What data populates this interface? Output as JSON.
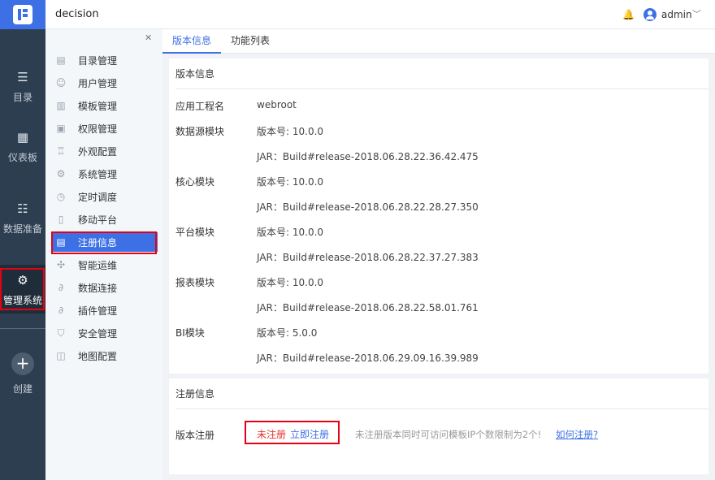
{
  "rail": {
    "items": [
      {
        "label": "目录",
        "icon": "list-icon"
      },
      {
        "label": "仪表板",
        "icon": "dashboard-icon"
      },
      {
        "label": "数据准备",
        "icon": "database-icon"
      },
      {
        "label": "管理系统",
        "icon": "gear-icon"
      }
    ],
    "create_label": "创建"
  },
  "header": {
    "title": "decision",
    "user": "admin"
  },
  "subnav": {
    "items": [
      {
        "label": "目录管理"
      },
      {
        "label": "用户管理"
      },
      {
        "label": "模板管理"
      },
      {
        "label": "权限管理"
      },
      {
        "label": "外观配置"
      },
      {
        "label": "系统管理"
      },
      {
        "label": "定时调度"
      },
      {
        "label": "移动平台"
      },
      {
        "label": "注册信息"
      },
      {
        "label": "智能运维"
      },
      {
        "label": "数据连接"
      },
      {
        "label": "插件管理"
      },
      {
        "label": "安全管理"
      },
      {
        "label": "地图配置"
      }
    ]
  },
  "tabs": [
    {
      "label": "版本信息"
    },
    {
      "label": "功能列表"
    }
  ],
  "version_panel": {
    "title": "版本信息",
    "app_label": "应用工程名",
    "app_value": "webroot",
    "modules": [
      {
        "name": "数据源模块",
        "version": "版本号: 10.0.0",
        "jar": "JAR：Build#release-2018.06.28.22.36.42.475"
      },
      {
        "name": "核心模块",
        "version": "版本号: 10.0.0",
        "jar": "JAR：Build#release-2018.06.28.22.28.27.350"
      },
      {
        "name": "平台模块",
        "version": "版本号: 10.0.0",
        "jar": "JAR：Build#release-2018.06.28.22.37.27.383"
      },
      {
        "name": "报表模块",
        "version": "版本号: 10.0.0",
        "jar": "JAR：Build#release-2018.06.28.22.58.01.761"
      },
      {
        "name": "BI模块",
        "version": "版本号: 5.0.0",
        "jar": "JAR：Build#release-2018.06.29.09.16.39.989"
      }
    ]
  },
  "register_panel": {
    "title": "注册信息",
    "row_label": "版本注册",
    "status": "未注册",
    "register_link": "立即注册",
    "note": "未注册版本同时可访问模板IP个数限制为2个!",
    "howto_link": "如何注册?"
  },
  "colors": {
    "accent": "#3d70e5",
    "rail_bg": "#2c3e50",
    "highlight_box": "#e50012",
    "unregistered": "#e5322d"
  }
}
